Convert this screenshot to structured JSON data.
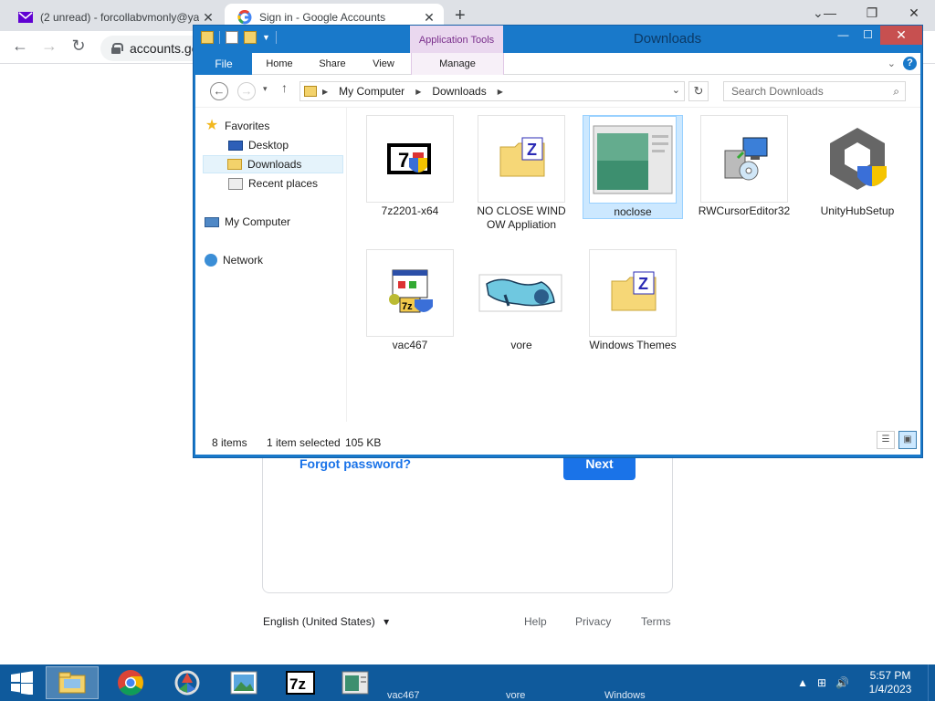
{
  "browser": {
    "tabs": [
      {
        "title": "(2 unread) - forcollabvmonly@ya",
        "icon": "mail-icon"
      },
      {
        "title": "Sign in - Google Accounts",
        "icon": "google-g-icon"
      }
    ],
    "close_glyph": "✕",
    "new_tab_glyph": "+",
    "tab_list_glyph": "⌄",
    "window_controls": {
      "minimize": "—",
      "restore": "❐",
      "close": "✕"
    },
    "nav": {
      "back": "←",
      "forward": "→",
      "reload": "↻"
    },
    "url": "accounts.google.com"
  },
  "signin": {
    "forgot_password": "Forgot password?",
    "next_button": "Next",
    "footer": {
      "language": "English (United States)",
      "language_arrow": "▾",
      "help": "Help",
      "privacy": "Privacy",
      "terms": "Terms"
    }
  },
  "explorer": {
    "title": "Downloads",
    "context_tab": "Application Tools",
    "window_controls": {
      "minimize": "—",
      "maximize": "☐",
      "close": "✕"
    },
    "ribbon_tabs": {
      "file": "File",
      "home": "Home",
      "share": "Share",
      "view": "View",
      "manage": "Manage"
    },
    "ribbon_help": "?",
    "ribbon_chevron": "⌄",
    "address": {
      "back": "←",
      "forward": "→",
      "recent": "▾",
      "up": "↑",
      "segments": [
        "My Computer",
        "Downloads"
      ],
      "separator": "▶",
      "dropdown": "⌄",
      "refresh": "↻"
    },
    "search_placeholder": "Search Downloads",
    "search_icon": "⌕",
    "nav_pane": {
      "favorites": "Favorites",
      "desktop": "Desktop",
      "downloads": "Downloads",
      "recent_places": "Recent places",
      "my_computer": "My Computer",
      "network": "Network"
    },
    "files": [
      {
        "name": "7z2201-x64",
        "icon": "7zip-installer-icon"
      },
      {
        "name": "NO CLOSE WINDOW Appliation",
        "icon": "zipped-folder-icon"
      },
      {
        "name": "noclose",
        "icon": "window-thumbnail-icon",
        "selected": true
      },
      {
        "name": "RWCursorEditor32",
        "icon": "setup-installer-icon"
      },
      {
        "name": "UnityHubSetup",
        "icon": "unity-hub-icon"
      },
      {
        "name": "vac467",
        "icon": "7zip-sfx-icon"
      },
      {
        "name": "vore",
        "icon": "picture-thumbnail-icon"
      },
      {
        "name": "Windows Themes",
        "icon": "zipped-folder-icon"
      }
    ],
    "status": {
      "count": "8 items",
      "selection": "1 item selected",
      "size": "105 KB"
    },
    "view_buttons": {
      "details": "☰",
      "large_icons": "▣"
    }
  },
  "taskbar": {
    "items": [
      "file-explorer-icon",
      "chrome-icon",
      "sync-app-icon",
      "photo-viewer-icon",
      "7zip-icon",
      "window-app-icon"
    ],
    "ghost_labels": [
      "vac467",
      "vore",
      "Windows"
    ],
    "tray": {
      "up_arrow": "▲",
      "network": "⊞",
      "volume": "🔊"
    },
    "time": "5:57 PM",
    "date": "1/4/2023"
  },
  "colors": {
    "explorer_frame": "#1979ca",
    "taskbar": "#0f5a9c",
    "google_blue": "#1a73e8",
    "selection": "#cce8ff"
  }
}
